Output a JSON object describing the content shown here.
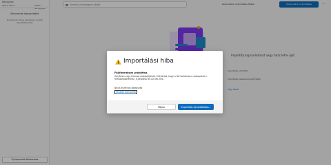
{
  "sidebar": {
    "app_title": "Névjegyek",
    "link_a": "Szűrő: Nincs",
    "link_b": "Szűrő: Névjegyek",
    "empty_title": "Nincsenek kapcsolatok",
    "empty_desc": "Itt jelennek meg a névjegyek, miután importáltad őket.",
    "new_button": "Új kapcsolat létrehozása"
  },
  "header": {
    "search_placeholder": "Keresés a névjegyek között",
    "top_link": "Kapcsolatok importálása fájlból",
    "top_button": "Kapcsolatok importálása",
    "more": "⋯"
  },
  "background": {
    "headline": "Importálj kapcsolatokat vagy hozz létre újat.",
    "line1": "Importálás a felhőből",
    "line2": "Importálás vesszővel tagolt fájlból",
    "link": "vagy fájlból"
  },
  "dialog": {
    "title": "Importálási hiba",
    "error_heading": "Fájlformátum probléma",
    "error_desc": "Helytelen vagy hiányzó oszlopfejlécek. Ellenőrizd, hogy a fájl tartalmaz-e oszlopokat a felhasználónévhez, a jelszóhoz és az URL-hez.",
    "error_count": "Nincs érvényes bejegyzés",
    "more_info": "További tudnivalók",
    "back_button": "Mégse",
    "retry_button": "Importálás újrapróbálása..."
  },
  "colors": {
    "accent": "#0f6cbd",
    "warning": "#f2b200"
  }
}
